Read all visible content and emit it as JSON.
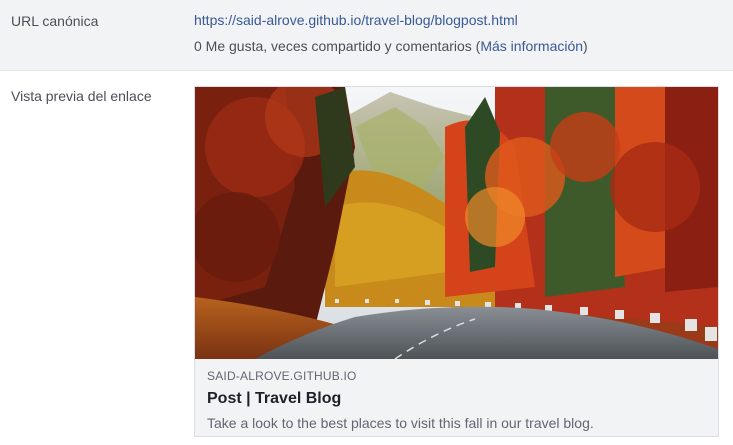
{
  "canonical": {
    "label": "URL canónica",
    "url": "https://said-alrove.github.io/travel-blog/blogpost.html",
    "stats_text": "0 Me gusta, veces compartido y comentarios (",
    "more_info_link": "Más información",
    "stats_suffix": ")"
  },
  "preview": {
    "label": "Vista previa del enlace",
    "image_icon": "autumn-forest-road-image",
    "domain": "SAID-ALROVE.GITHUB.IO",
    "title": "Post | Travel Blog",
    "description": "Take a look to the best places to visit this fall in our travel blog."
  },
  "colors": {
    "link": "#385898",
    "label": "#4b4f56",
    "row_background": "#f2f3f5",
    "card_border": "#dadde1"
  }
}
